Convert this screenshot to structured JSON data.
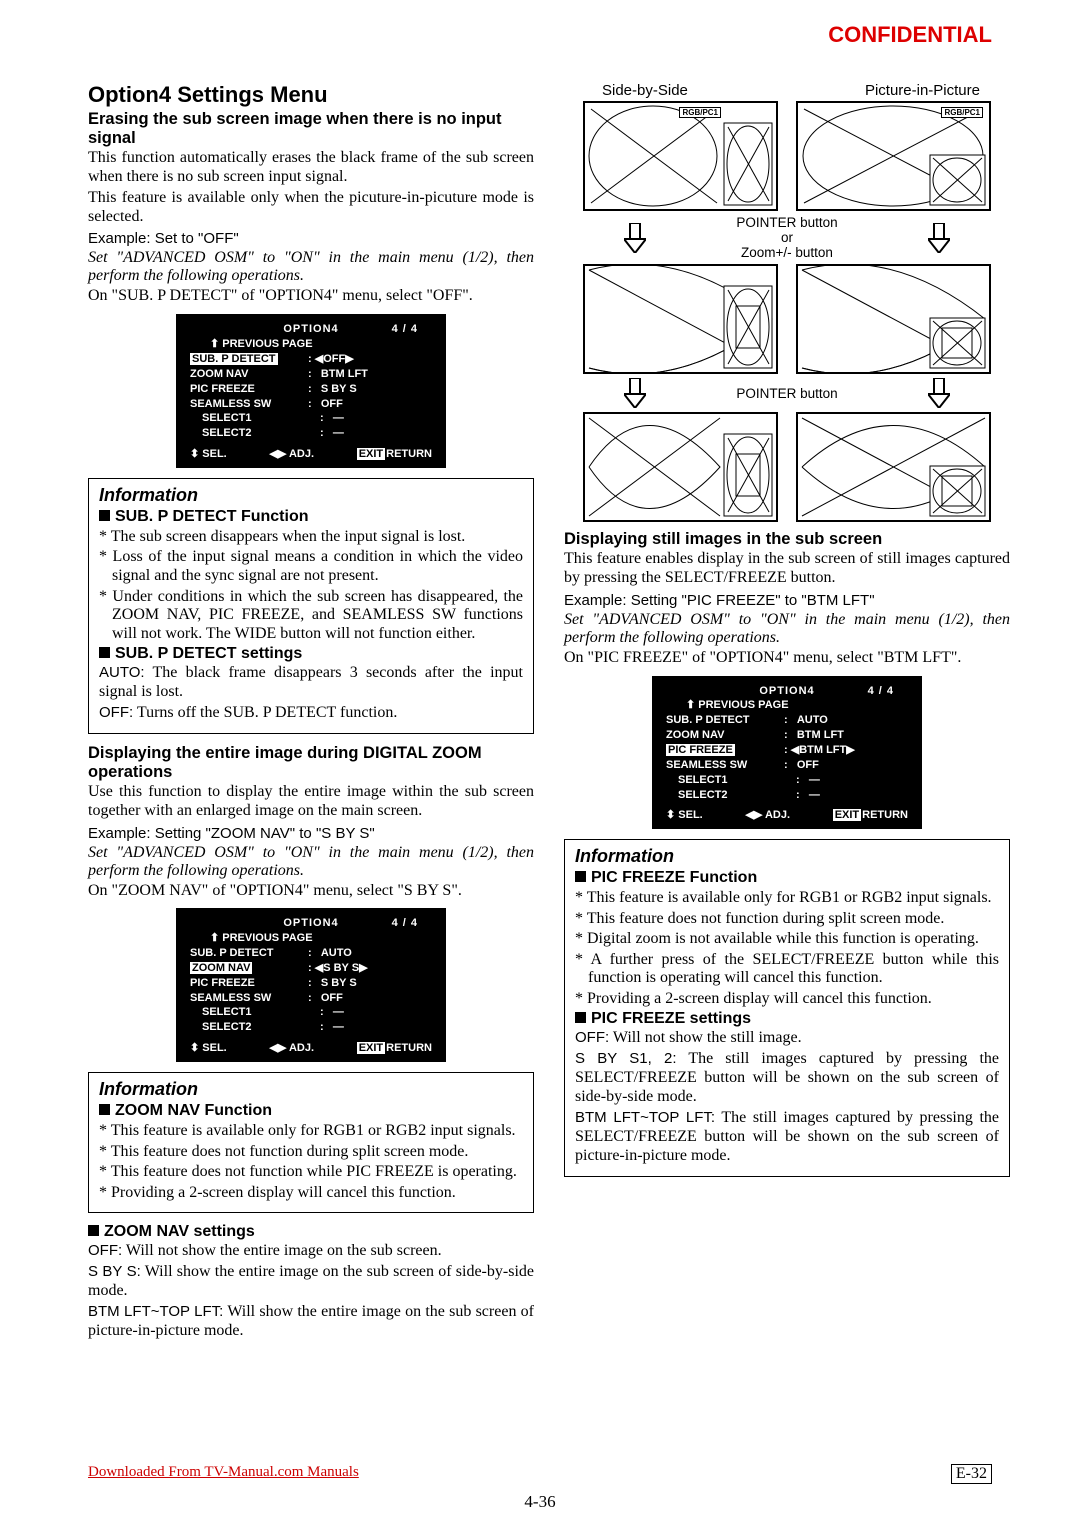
{
  "hdr": {
    "conf": "CONFIDENTIAL"
  },
  "col1": {
    "h1": "Option4 Settings Menu",
    "s1h": "Erasing the sub screen image when there is no input signal",
    "s1p1": "This function automatically erases the black frame of the sub screen when there is no sub screen input signal.",
    "s1p2": "This feature is available only when the picuture-in-picuture mode is selected.",
    "s1ex": "Example: Set to \"OFF\"",
    "adv": "Set \"ADVANCED OSM\" to \"ON\" in the main menu (1/2), then perform the following operations.",
    "s1p3": "On \"SUB. P DETECT\" of \"OPTION4\" menu, select \"OFF\".",
    "info1": "Information",
    "i1a": "SUB. P DETECT Function",
    "i1a1": "* The sub screen disappears when the input signal is lost.",
    "i1a2": "* Loss of the input signal means a condition in which the video signal and the sync signal are not present.",
    "i1a3": "* Under conditions in which the sub screen has disappeared, the ZOOM NAV, PIC FREEZE, and SEAMLESS SW functions will not work. The WIDE button will not function either.",
    "i1b": "SUB. P DETECT settings",
    "i1b1": "The black frame disappears 3 seconds after the input signal is lost.",
    "i1b1l": "AUTO:",
    "i1b2": "Turns off the SUB. P DETECT function.",
    "i1b2l": "OFF:",
    "s2h": "Displaying the entire image during DIGITAL ZOOM operations",
    "s2p1": "Use this function to display the entire image within the sub screen together with an enlarged image on the main screen.",
    "s2ex": "Example: Setting \"ZOOM NAV\" to \"S BY S\"",
    "s2p2": "On \"ZOOM NAV\" of \"OPTION4\" menu, select \"S BY S\".",
    "info2": "Information",
    "i2a": "ZOOM NAV Function",
    "i2a1": "* This feature is available only for RGB1 or RGB2 input signals.",
    "i2a2": "* This feature does not function during split screen mode.",
    "i2a3": "* This feature does not function while PIC FREEZE is operating.",
    "i2a4": "* Providing a 2-screen display will cancel this function."
  },
  "col2": {
    "zh": "ZOOM NAV settings",
    "z1l": "OFF:",
    "z1": "Will not show the entire image on the sub screen.",
    "z2l": "S BY S:",
    "z2": "Will show the entire image on the sub screen of side-by-side mode.",
    "z3l": "BTM LFT~TOP LFT:",
    "z3": "Will show the entire image on the sub screen of picture-in-picture mode.",
    "dt1": "Side-by-Side",
    "dt2": "Picture-in-Picture",
    "rgb": "RGB/PC1",
    "bt1a": "POINTER button",
    "bt1b": "or",
    "bt1c": "Zoom+/- button",
    "bt2": "POINTER button",
    "s3h": "Displaying still images in the sub screen",
    "s3p1": "This feature enables display in the sub screen of still images captured by pressing the SELECT/FREEZE button.",
    "s3ex": "Example: Setting \"PIC FREEZE\" to \"BTM LFT\"",
    "s3p2": "On \"PIC FREEZE\" of \"OPTION4\" menu, select \"BTM LFT\".",
    "info3": "Information",
    "i3a": "PIC FREEZE Function",
    "i3a1": "* This feature is available only for RGB1 or RGB2 input signals.",
    "i3a2": "* This feature does not function during split screen mode.",
    "i3a3": "* Digital zoom is not available while this function is operating.",
    "i3a4": "* A further press of the SELECT/FREEZE button while this function is operating will cancel this function.",
    "i3a5": "* Providing a 2-screen display will cancel this function.",
    "i3b": "PIC FREEZE settings",
    "i3b1l": "OFF:",
    "i3b1": "Will not show the still image.",
    "i3b2l": "S BY S1, 2:",
    "i3b2": "The still images captured by pressing the SELECT/FREEZE button will be shown on the sub screen of side-by-side mode.",
    "i3b3l": "BTM LFT~TOP LFT:",
    "i3b3": "The still images captured by pressing the SELECT/FREEZE button will be shown on the sub screen of picture-in-picture mode."
  },
  "osd": {
    "title": "OPTION4",
    "pg": "4 / 4",
    "prev": "PREVIOUS PAGE",
    "r1": "SUB. P DETECT",
    "r2": "ZOOM NAV",
    "r3": "PIC FREEZE",
    "r4": "SEAMLESS SW",
    "r5": "SELECT1",
    "r6": "SELECT2",
    "sel": "SEL.",
    "adj": "ADJ.",
    "exit": "EXIT",
    "ret": "RETURN",
    "v_off": "OFF",
    "v_btm": "BTM LFT",
    "v_sbs": "S BY S",
    "v_auto": "AUTO",
    "v_dash": "—"
  },
  "foot": {
    "dl": "Downloaded From TV-Manual.com Manuals",
    "pn": "E-32",
    "cn": "4-36"
  }
}
